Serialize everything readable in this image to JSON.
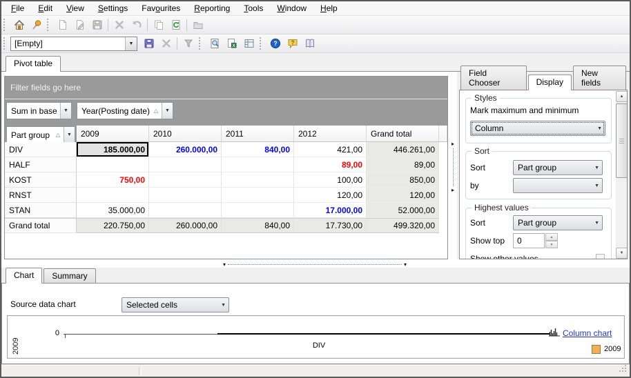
{
  "menubar": {
    "items": [
      {
        "label": "File",
        "key_index": 0
      },
      {
        "label": "Edit",
        "key_index": 0
      },
      {
        "label": "View",
        "key_index": 0
      },
      {
        "label": "Settings",
        "key_index": 0
      },
      {
        "label": "Favourites",
        "key_index": 3
      },
      {
        "label": "Reporting",
        "key_index": 0
      },
      {
        "label": "Tools",
        "key_index": 0
      },
      {
        "label": "Window",
        "key_index": 0
      },
      {
        "label": "Help",
        "key_index": 0
      }
    ]
  },
  "toolbar_main": {
    "icons": [
      "home",
      "pushpin",
      "new-document",
      "edit-document",
      "save",
      "delete",
      "undo",
      "copy",
      "refresh",
      "open-folder"
    ]
  },
  "toolbar_layout": {
    "combo_value": "[Empty]",
    "icons": [
      "save-layout",
      "delete-layout",
      "filter",
      "print-preview",
      "export-excel",
      "pivot-options",
      "help",
      "context-help",
      "manual"
    ]
  },
  "main_tab": {
    "label": "Pivot table"
  },
  "pivot": {
    "filter_area_text": "Filter fields go here",
    "data_field": "Sum in base cu",
    "column_field": "Year(Posting date)",
    "row_field": "Part group",
    "columns": [
      "2009",
      "2010",
      "2011",
      "2012",
      "Grand total"
    ],
    "rows": [
      {
        "label": "DIV",
        "cells": [
          {
            "t": "185.000,00",
            "s": "sel"
          },
          {
            "t": "260.000,00",
            "s": "max"
          },
          {
            "t": "840,00",
            "s": "max"
          },
          {
            "t": "421,00",
            "s": ""
          },
          {
            "t": "446.261,00",
            "s": "tot"
          }
        ]
      },
      {
        "label": "HALF",
        "cells": [
          {
            "t": "",
            "s": ""
          },
          {
            "t": "",
            "s": ""
          },
          {
            "t": "",
            "s": ""
          },
          {
            "t": "89,00",
            "s": "min"
          },
          {
            "t": "89,00",
            "s": "tot"
          }
        ]
      },
      {
        "label": "KOST",
        "cells": [
          {
            "t": "750,00",
            "s": "min"
          },
          {
            "t": "",
            "s": ""
          },
          {
            "t": "",
            "s": ""
          },
          {
            "t": "100,00",
            "s": ""
          },
          {
            "t": "850,00",
            "s": "tot"
          }
        ]
      },
      {
        "label": "RNST",
        "cells": [
          {
            "t": "",
            "s": ""
          },
          {
            "t": "",
            "s": ""
          },
          {
            "t": "",
            "s": ""
          },
          {
            "t": "120,00",
            "s": ""
          },
          {
            "t": "120,00",
            "s": "tot"
          }
        ]
      },
      {
        "label": "STAN",
        "cells": [
          {
            "t": "35.000,00",
            "s": ""
          },
          {
            "t": "",
            "s": ""
          },
          {
            "t": "",
            "s": ""
          },
          {
            "t": "17.000,00",
            "s": "max"
          },
          {
            "t": "52.000,00",
            "s": "tot"
          }
        ]
      },
      {
        "label": "Grand total",
        "is_total": true,
        "cells": [
          {
            "t": "220.750,00",
            "s": "tot"
          },
          {
            "t": "260.000,00",
            "s": "tot"
          },
          {
            "t": "840,00",
            "s": "tot"
          },
          {
            "t": "17.730,00",
            "s": "tot"
          },
          {
            "t": "499.320,00",
            "s": "tot"
          }
        ]
      }
    ],
    "colors": {
      "max_value": "#0000ff",
      "min_value": "#ff0000"
    }
  },
  "field_panel": {
    "tabs": [
      {
        "label": "Field Chooser"
      },
      {
        "label": "Display"
      },
      {
        "label": "New fields"
      }
    ],
    "active_tab": "Display",
    "styles_group": {
      "title": "Styles",
      "mark_label": "Mark maximum and minimum",
      "mark_value": "Column"
    },
    "sort_group": {
      "title": "Sort",
      "sort_label": "Sort",
      "sort_value": "Part group",
      "by_label": "by",
      "by_value": ""
    },
    "highest_group": {
      "title": "Highest values",
      "sort_label": "Sort",
      "sort_value": "Part group",
      "show_top_label": "Show top",
      "show_top_value": "0",
      "show_other_label": "Show other values",
      "show_other_checked": false
    }
  },
  "bottom_panel": {
    "tabs": [
      {
        "label": "Chart"
      },
      {
        "label": "Summary"
      }
    ],
    "active_tab": "Chart",
    "source_label": "Source data chart",
    "source_value": "Selected cells",
    "chart": {
      "value_axis_label": "2009",
      "value_tick": "0",
      "category_label": "DIV",
      "chart_type_link": "Column chart",
      "legend": [
        {
          "label": "2009",
          "color": "#f5ad56"
        }
      ]
    }
  }
}
